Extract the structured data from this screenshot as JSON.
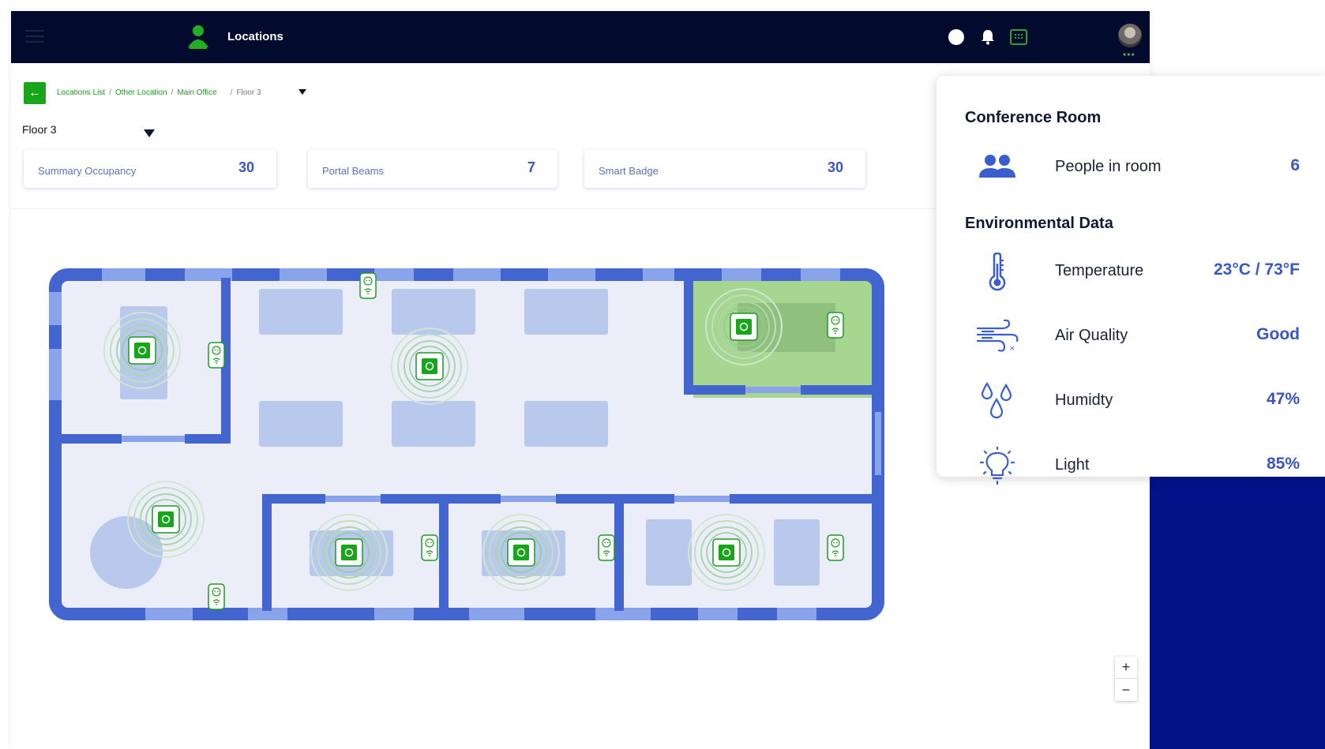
{
  "header": {
    "title": "Locations"
  },
  "breadcrumb": {
    "items": [
      "Locations List",
      "Other Location",
      "Main Office"
    ],
    "current": "Floor 3"
  },
  "floor_selector": {
    "value": "Floor 3"
  },
  "stats": [
    {
      "label": "Summary Occupancy",
      "value": "30"
    },
    {
      "label": "Portal Beams",
      "value": "7"
    },
    {
      "label": "Smart Badge",
      "value": "30"
    }
  ],
  "zoom": {
    "in": "+",
    "out": "−"
  },
  "panel": {
    "room_title": "Conference Room",
    "people": {
      "label": "People in room",
      "value": "6",
      "icon": "people-icon"
    },
    "env_title": "Environmental Data",
    "env": [
      {
        "label": "Temperature",
        "value": "23°C / 73°F",
        "icon": "thermometer-icon"
      },
      {
        "label": "Air Quality",
        "value": "Good",
        "icon": "wind-icon"
      },
      {
        "label": "Humidty",
        "value": "47%",
        "icon": "droplets-icon"
      },
      {
        "label": "Light",
        "value": "85%",
        "icon": "lightbulb-icon"
      }
    ]
  },
  "colors": {
    "accent_green": "#18a51b",
    "brand_blue": "#3a56c4",
    "navbar": "#020a2e",
    "highlight_room": "#a6d68f"
  }
}
